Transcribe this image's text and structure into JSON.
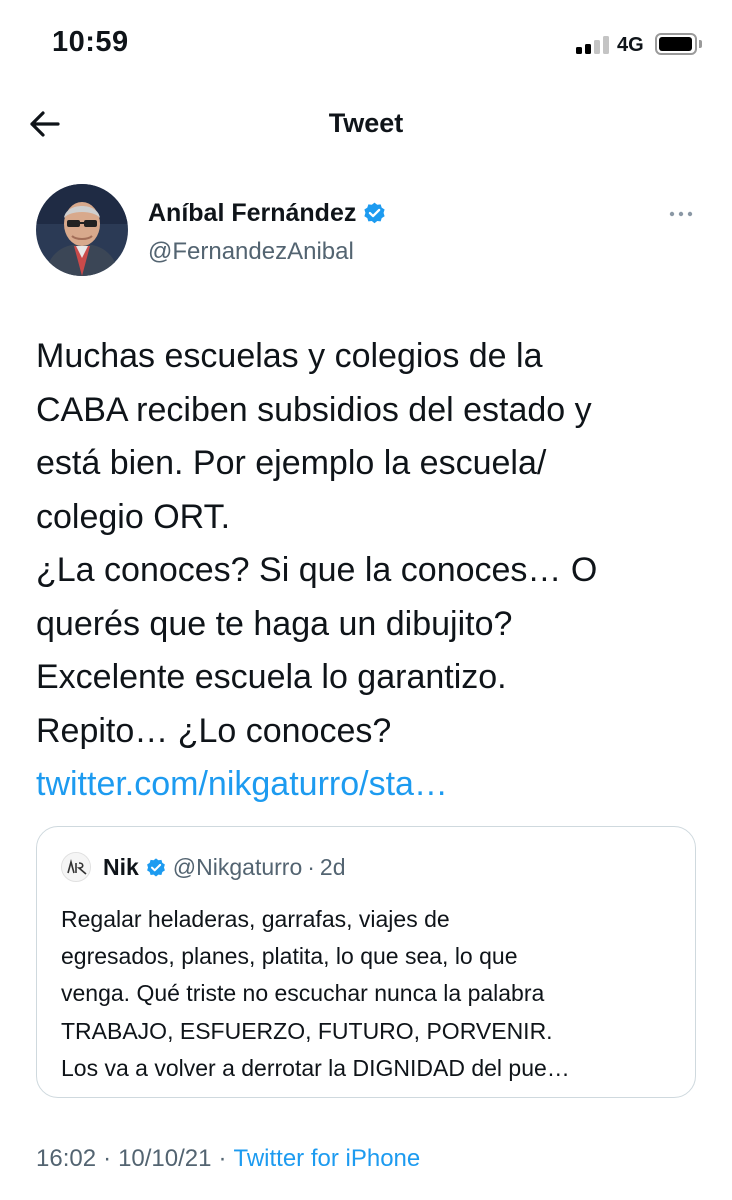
{
  "status_bar": {
    "time": "10:59",
    "network": "4G",
    "signal_bars_active": 2,
    "signal_bars_total": 4,
    "battery_level": 0.85
  },
  "nav": {
    "back_icon": "arrow-left-icon",
    "title": "Tweet"
  },
  "author": {
    "name": "Aníbal Fernández",
    "handle": "@FernandezAnibal",
    "verified": true,
    "more_icon": "more-horizontal-icon"
  },
  "tweet": {
    "lines": [
      "Muchas escuelas y colegios de la",
      "CABA reciben subsidios del estado y",
      "está bien. Por ejemplo la escuela/",
      "colegio ORT.",
      "¿La conoces? Si que la conoces… O",
      "querés que te haga un dibujito?",
      "Excelente escuela lo garantizo.",
      "Repito… ¿Lo conoces?"
    ],
    "link": "twitter.com/nikgaturro/sta…"
  },
  "quote": {
    "name": "Nik",
    "verified": true,
    "handle": "@Nikgaturro",
    "separator": "·",
    "time": "2d",
    "lines": [
      "Regalar heladeras, garrafas, viajes de",
      "egresados, planes, platita, lo que sea, lo que",
      "venga. Qué triste no escuchar nunca la palabra",
      "TRABAJO, ESFUERZO, FUTURO, PORVENIR.",
      "Los va a volver a derrotar la DIGNIDAD del pue…"
    ]
  },
  "meta": {
    "time": "16:02",
    "separator": "·",
    "date": "10/10/21",
    "source": "Twitter for iPhone"
  },
  "colors": {
    "link": "#1d9bf0",
    "verified": "#1d9bf0",
    "secondary_text": "#536471",
    "border": "#cfd9de"
  }
}
